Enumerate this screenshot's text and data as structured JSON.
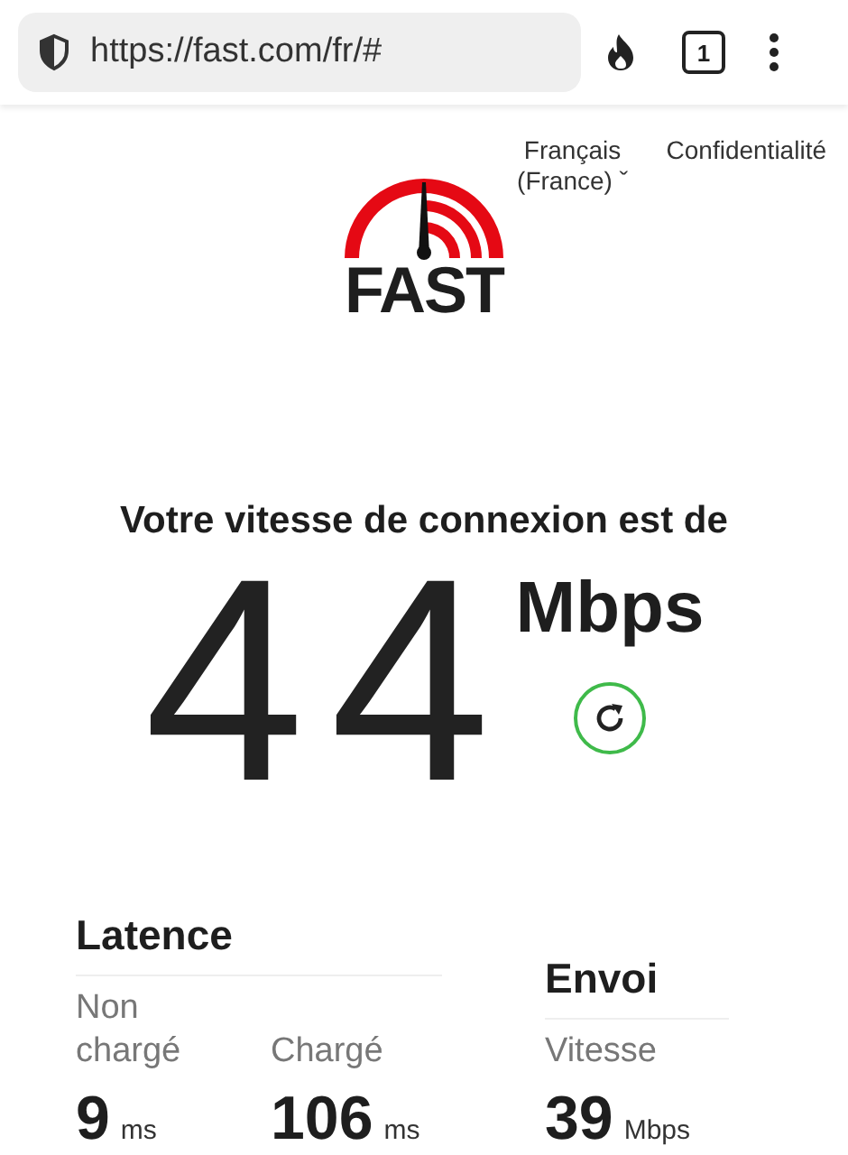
{
  "browser": {
    "url": "https://fast.com/fr/#",
    "tab_count": "1"
  },
  "header": {
    "logo_text": "FAST",
    "language": "Français (France)",
    "language_caret": "ˇ",
    "privacy": "Confidentialité"
  },
  "result": {
    "heading": "Votre vitesse de connexion est de",
    "speed": "44",
    "unit": "Mbps"
  },
  "latency": {
    "title": "Latence",
    "metrics": [
      {
        "label": "Non chargé",
        "value": "9",
        "unit": "ms"
      },
      {
        "label": "Chargé",
        "value": "106",
        "unit": "ms"
      }
    ]
  },
  "upload": {
    "title": "Envoi",
    "metrics": [
      {
        "label": "Vitesse",
        "value": "39",
        "unit": "Mbps"
      }
    ]
  }
}
